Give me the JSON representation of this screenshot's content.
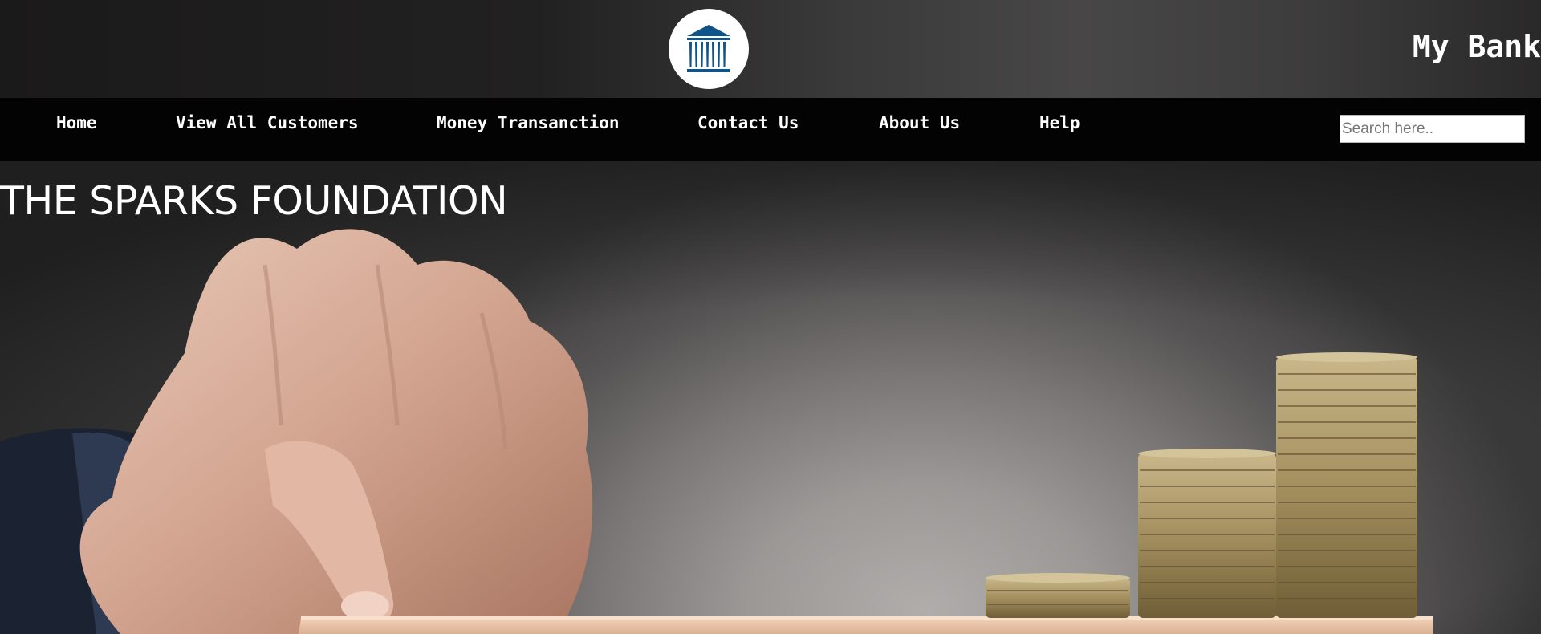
{
  "header": {
    "logo": {
      "icon": "bank-building-icon",
      "color": "#0e5389"
    },
    "brand": "My Bank"
  },
  "nav": {
    "items": [
      {
        "label": "Home"
      },
      {
        "label": "View All Customers"
      },
      {
        "label": "Money Transanction"
      },
      {
        "label": "Contact Us"
      },
      {
        "label": "About Us"
      },
      {
        "label": "Help"
      }
    ],
    "search": {
      "placeholder": "Search here..",
      "value": ""
    }
  },
  "hero": {
    "title": "THE SPARKS FOUNDATION",
    "image": "hand-pushing-coin-stacks-image"
  }
}
